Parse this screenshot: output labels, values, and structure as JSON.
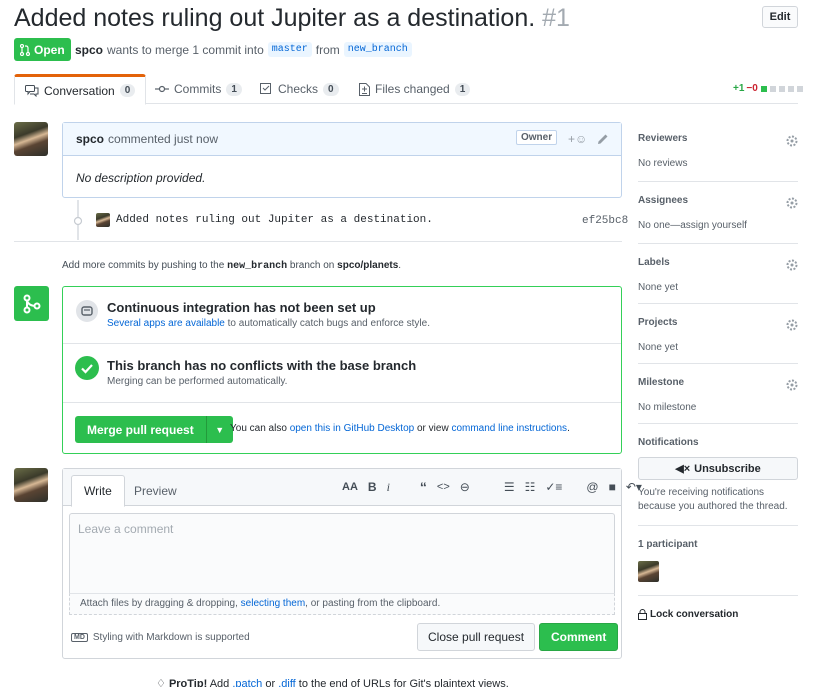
{
  "pr": {
    "title": "Added notes ruling out Jupiter as a destination.",
    "number": "#1",
    "edit_label": "Edit",
    "state": "Open",
    "author": "spco",
    "meta_text": "wants to merge 1 commit into",
    "base_branch": "master",
    "from_text": "from",
    "head_branch": "new_branch"
  },
  "tabs": [
    {
      "label": "Conversation",
      "count": "0"
    },
    {
      "label": "Commits",
      "count": "1"
    },
    {
      "label": "Checks",
      "count": "0"
    },
    {
      "label": "Files changed",
      "count": "1"
    }
  ],
  "diffstat": {
    "additions": "+1",
    "deletions": "−0"
  },
  "comment": {
    "author": "spco",
    "action": "commented just now",
    "role": "Owner",
    "body": "No description provided."
  },
  "commit": {
    "message": "Added notes ruling out Jupiter as a destination.",
    "sha": "ef25bc8"
  },
  "hint": {
    "prefix": "Add more commits by pushing to the",
    "branch": "new_branch",
    "middle": "branch on",
    "repo": "spco/planets",
    "suffix": "."
  },
  "merge": {
    "ci_title": "Continuous integration has not been set up",
    "ci_link": "Several apps are available",
    "ci_rest": "to automatically catch bugs and enforce style.",
    "conflict_title": "This branch has no conflicts with the base branch",
    "conflict_sub": "Merging can be performed automatically.",
    "merge_label": "Merge pull request",
    "note_prefix": "You can also",
    "note_link1": "open this in GitHub Desktop",
    "note_middle": "or view",
    "note_link2": "command line instructions",
    "note_suffix": "."
  },
  "editor": {
    "write_tab": "Write",
    "preview_tab": "Preview",
    "placeholder": "Leave a comment",
    "attach_prefix": "Attach files by dragging & dropping,",
    "attach_link": "selecting them",
    "attach_suffix": ", or pasting from the clipboard.",
    "markdown_badge": "MD",
    "markdown_note": "Styling with Markdown is supported",
    "close_label": "Close pull request",
    "comment_label": "Comment"
  },
  "protip": {
    "label": "ProTip!",
    "text1": "Add",
    "link1": ".patch",
    "text2": "or",
    "link2": ".diff",
    "text3": "to the end of URLs for Git's plaintext views."
  },
  "sidebar": {
    "reviewers": {
      "heading": "Reviewers",
      "value": "No reviews"
    },
    "assignees": {
      "heading": "Assignees",
      "value": "No one—assign yourself"
    },
    "labels": {
      "heading": "Labels",
      "value": "None yet"
    },
    "projects": {
      "heading": "Projects",
      "value": "None yet"
    },
    "milestone": {
      "heading": "Milestone",
      "value": "No milestone"
    },
    "notifications": {
      "heading": "Notifications",
      "button": "Unsubscribe",
      "text": "You're receiving notifications because you authored the thread."
    },
    "participants": {
      "heading": "1 participant"
    },
    "lock": "Lock conversation"
  },
  "colors": {
    "open_green": "#2cbe4e",
    "link_blue": "#0366d6",
    "tab_accent": "#e36209"
  }
}
